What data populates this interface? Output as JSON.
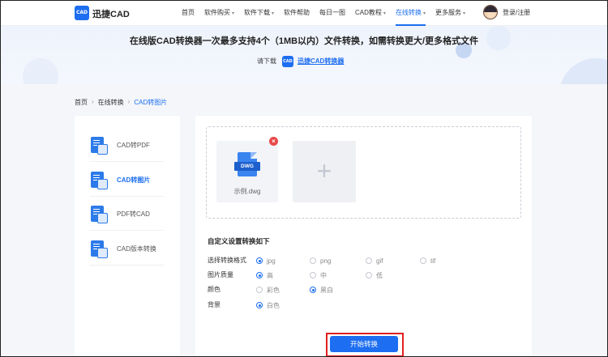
{
  "header": {
    "logo_text": "CAD",
    "brand": "迅捷CAD",
    "nav": [
      {
        "label": "首页",
        "dropdown": false,
        "active": false
      },
      {
        "label": "软件购买",
        "dropdown": true,
        "active": false
      },
      {
        "label": "软件下载",
        "dropdown": true,
        "active": false
      },
      {
        "label": "软件帮助",
        "dropdown": false,
        "active": false
      },
      {
        "label": "每日一图",
        "dropdown": false,
        "active": false
      },
      {
        "label": "CAD教程",
        "dropdown": true,
        "active": false
      },
      {
        "label": "在线转换",
        "dropdown": true,
        "active": true
      },
      {
        "label": "更多服务",
        "dropdown": true,
        "active": false
      }
    ],
    "login": "登录/注册"
  },
  "banner": {
    "title": "在线版CAD转换器一次最多支持4个（1MB以内）文件转换，如需转换更大/更多格式文件",
    "prompt": "请下载",
    "icon_text": "CAD",
    "link": "迅捷CAD转换器"
  },
  "breadcrumb": [
    "首页",
    "在线转换",
    "CAD转图片"
  ],
  "sidebar": [
    {
      "label": "CAD转PDF",
      "active": false,
      "icon": "cad-to-pdf-icon"
    },
    {
      "label": "CAD转图片",
      "active": true,
      "icon": "cad-to-image-icon"
    },
    {
      "label": "PDF转CAD",
      "active": false,
      "icon": "pdf-to-cad-icon"
    },
    {
      "label": "CAD版本转换",
      "active": false,
      "icon": "cad-version-icon"
    }
  ],
  "upload": {
    "file": {
      "tag": "DWG",
      "name": "示例.dwg"
    },
    "remove_symbol": "×",
    "add_symbol": "+"
  },
  "settings": {
    "title": "自定义设置转换如下",
    "rows": [
      {
        "label": "选择转换格式",
        "options": [
          {
            "label": "jpg",
            "checked": true
          },
          {
            "label": "png",
            "checked": false
          },
          {
            "label": "gif",
            "checked": false
          },
          {
            "label": "tif",
            "checked": false
          }
        ]
      },
      {
        "label": "图片质量",
        "options": [
          {
            "label": "高",
            "checked": true
          },
          {
            "label": "中",
            "checked": false
          },
          {
            "label": "低",
            "checked": false
          }
        ]
      },
      {
        "label": "颜色",
        "options": [
          {
            "label": "彩色",
            "checked": false
          },
          {
            "label": "黑白",
            "checked": true
          }
        ]
      },
      {
        "label": "背景",
        "options": [
          {
            "label": "白色",
            "checked": true
          }
        ]
      }
    ]
  },
  "actions": {
    "start": "开始转换"
  },
  "colors": {
    "accent": "#1d6ef0",
    "danger": "#e84848",
    "highlight": "#e02020"
  }
}
